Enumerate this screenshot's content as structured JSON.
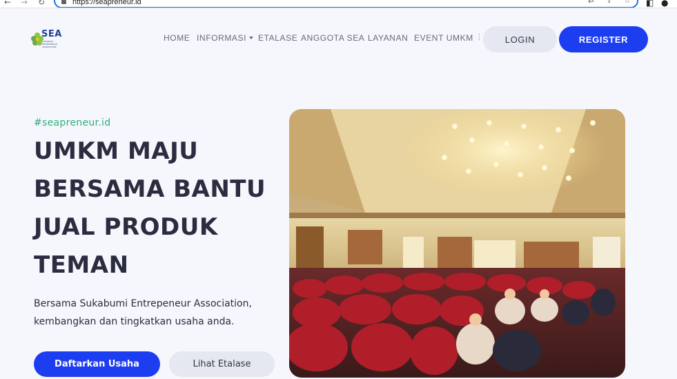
{
  "browser": {
    "url": "https://seapreneur.id",
    "back_icon": "arrow-left-icon",
    "forward_icon": "arrow-right-icon",
    "reload_icon": "reload-icon",
    "lock_icon": "lock-icon",
    "translate_icon": "translate-icon",
    "share_icon": "share-icon",
    "bookmark_icon": "star-icon",
    "sidepanel_icon": "side-panel-icon",
    "profile_icon": "profile-avatar-icon"
  },
  "header": {
    "logo_text": "SEA",
    "logo_subtext": "SUKABUMI ENTREPENEUR ASSOCIATION",
    "nav": [
      {
        "label": "HOME"
      },
      {
        "label": "INFORMASI"
      },
      {
        "label": "ETALASE"
      },
      {
        "label": "ANGGOTA SEA"
      },
      {
        "label": "LAYANAN"
      },
      {
        "label": "EVENT UMKM"
      }
    ],
    "more_icon": "more-vertical-icon",
    "login_label": "LOGIN",
    "register_label": "REGISTER"
  },
  "hero": {
    "tag": "#seapreneur.id",
    "headline": [
      "UMKM MAJU",
      "BERSAMA BANTU",
      "JUAL PRODUK",
      "TEMAN"
    ],
    "description": [
      "Bersama Sukabumi Entrepeneur Association,",
      "kembangkan dan tingkatkan usaha anda."
    ],
    "primary_button": "Daftarkan Usaha",
    "secondary_button": "Lihat Etalase",
    "photo": "event-audience-photo"
  },
  "colors": {
    "primary": "#1d3df0",
    "accent_green": "#2fae7a",
    "heading": "#2b2c40",
    "background": "#f5f7fc",
    "button_secondary": "#e5e8f0"
  }
}
